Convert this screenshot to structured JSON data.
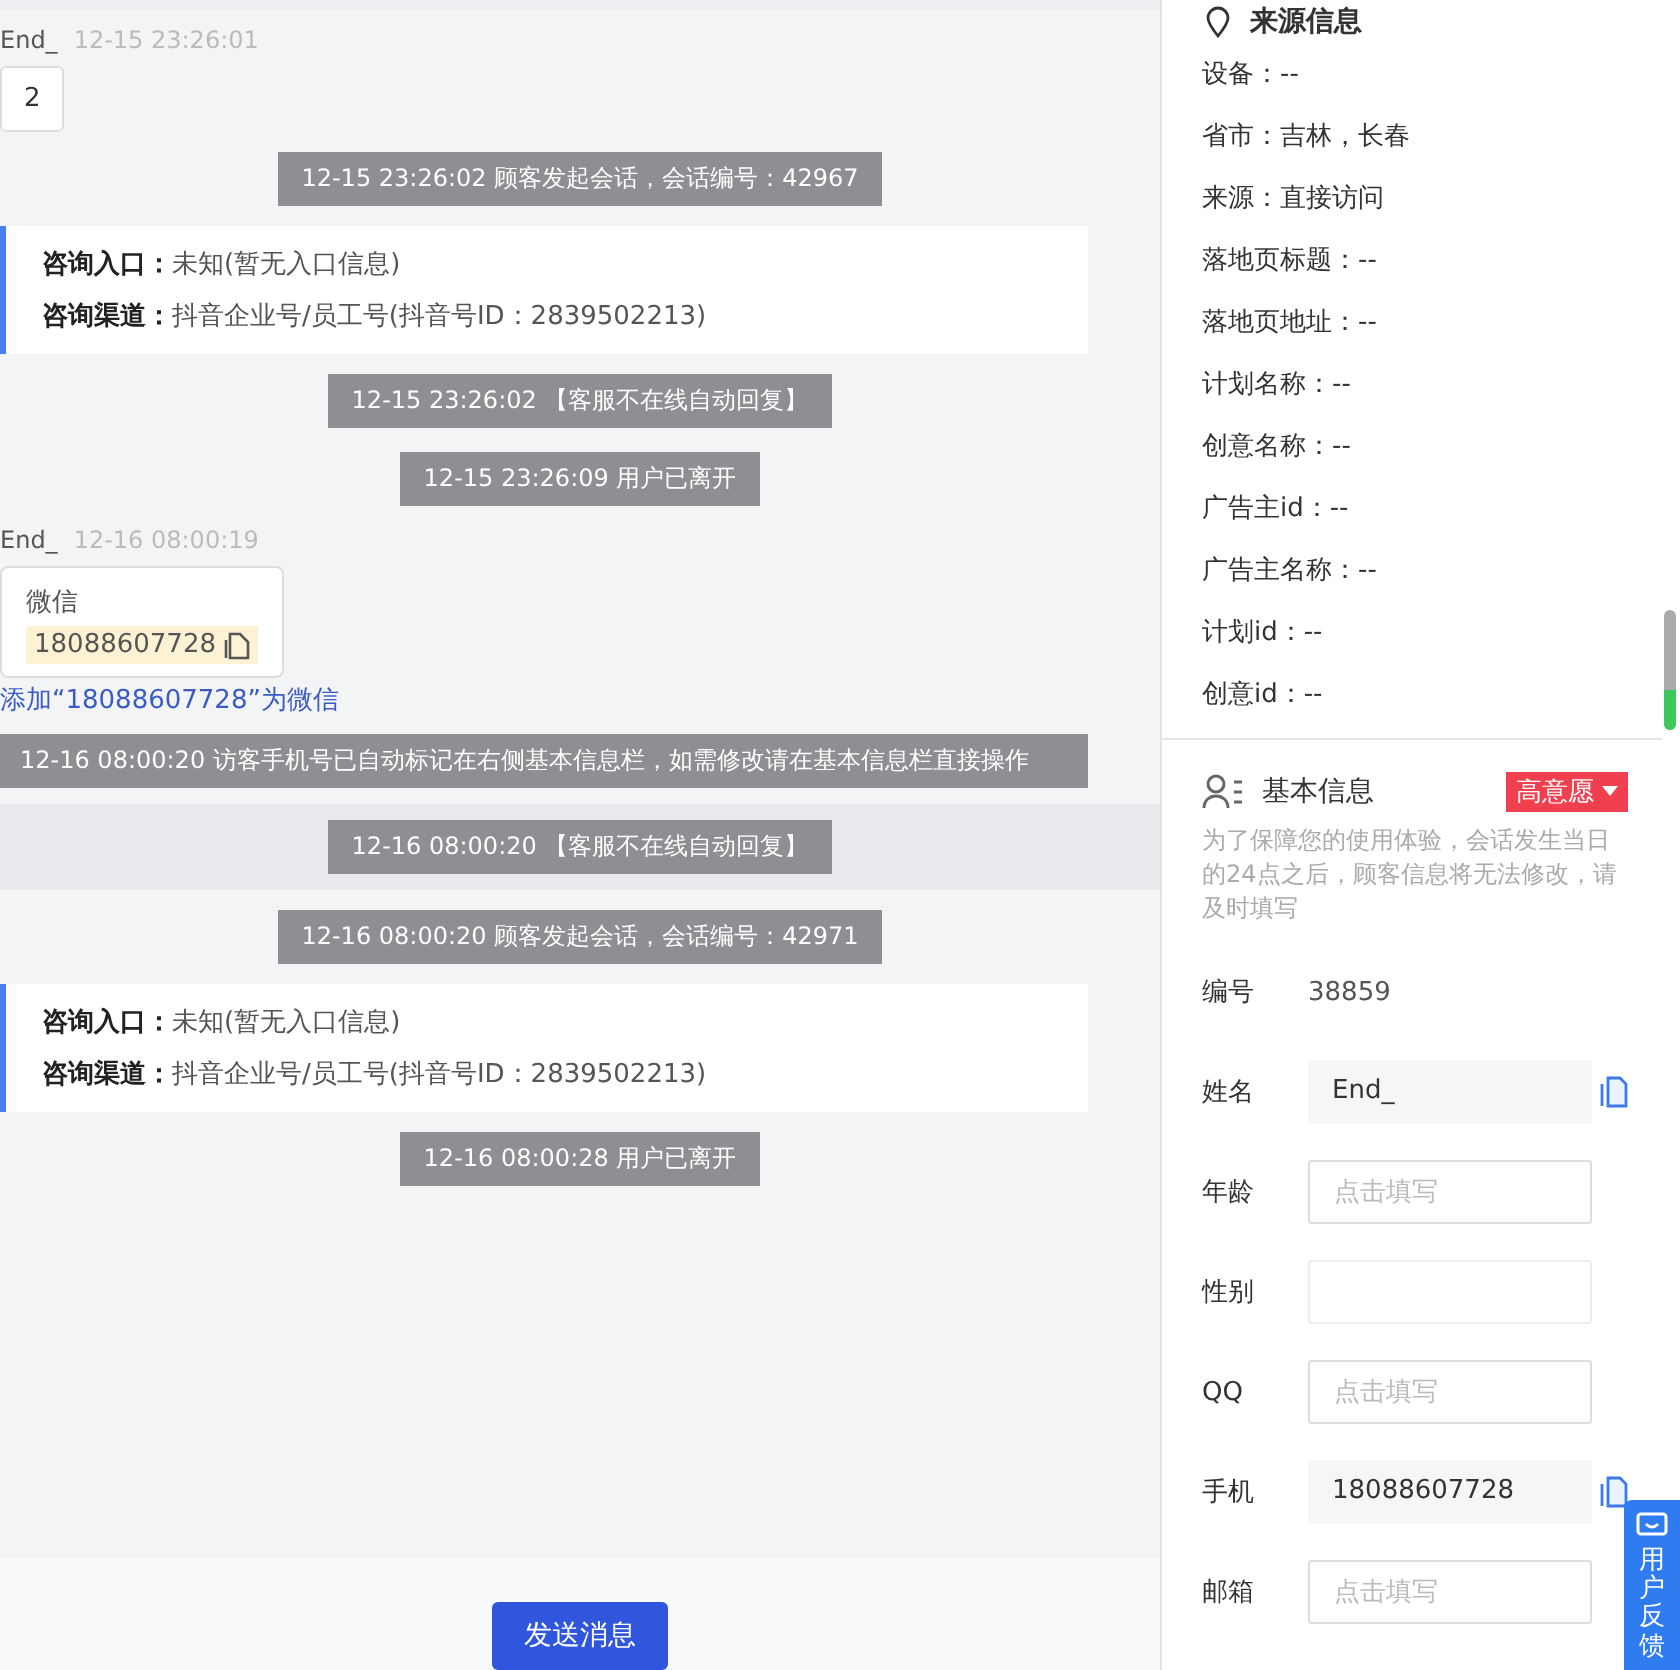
{
  "chat": {
    "messages": [
      {
        "kind": "user",
        "sender": "End_",
        "time": "12-15 23:26:01",
        "text": "2"
      },
      {
        "kind": "system",
        "highlighted": false,
        "text": "12-15 23:26:02 顾客发起会话，会话编号：42967"
      },
      {
        "kind": "consult",
        "rows": [
          {
            "label": "咨询入口：",
            "value": "未知(暂无入口信息)"
          },
          {
            "label": "咨询渠道：",
            "value": "抖音企业号/员工号(抖音号ID：2839502213)"
          }
        ]
      },
      {
        "kind": "system",
        "highlighted": false,
        "text": "12-15 23:26:02 【客服不在线自动回复】"
      },
      {
        "kind": "system",
        "highlighted": false,
        "text": "12-15 23:26:09 用户已离开"
      },
      {
        "kind": "card",
        "sender": "End_",
        "time": "12-16 08:00:19",
        "title": "微信",
        "value": "18088607728",
        "link": "添加“18088607728”为微信"
      },
      {
        "kind": "notice",
        "text": "12-16 08:00:20 访客手机号已自动标记在右侧基本信息栏，如需修改请在基本信息栏直接操作"
      },
      {
        "kind": "system",
        "highlighted": true,
        "text": "12-16 08:00:20 【客服不在线自动回复】"
      },
      {
        "kind": "system",
        "highlighted": false,
        "text": "12-16 08:00:20 顾客发起会话，会话编号：42971"
      },
      {
        "kind": "consult",
        "rows": [
          {
            "label": "咨询入口：",
            "value": "未知(暂无入口信息)"
          },
          {
            "label": "咨询渠道：",
            "value": "抖音企业号/员工号(抖音号ID：2839502213)"
          }
        ]
      },
      {
        "kind": "system",
        "highlighted": false,
        "text": "12-16 08:00:28 用户已离开"
      }
    ]
  },
  "send_button": "发送消息",
  "source_info": {
    "title": "来源信息",
    "items": [
      "设备：--",
      "省市：吉林，长春",
      "来源：直接访问",
      "落地页标题：--",
      "落地页地址：--",
      "计划名称：--",
      "创意名称：--",
      "广告主id：--",
      "广告主名称：--",
      "计划id：--",
      "创意id：--"
    ]
  },
  "basic_info": {
    "title": "基本信息",
    "tag": "高意愿",
    "note": "为了保障您的使用体验，会话发生当日的24点之后，顾客信息将无法修改，请及时填写",
    "fields": [
      {
        "label": "编号",
        "kind": "text",
        "value": "38859"
      },
      {
        "label": "姓名",
        "kind": "readonly",
        "value": "End_"
      },
      {
        "label": "年龄",
        "kind": "input",
        "placeholder": "点击填写"
      },
      {
        "label": "性别",
        "kind": "select"
      },
      {
        "label": "QQ",
        "kind": "input",
        "placeholder": "点击填写"
      },
      {
        "label": "手机",
        "kind": "readonly",
        "value": "18088607728"
      },
      {
        "label": "邮箱",
        "kind": "input",
        "placeholder": "点击填写"
      }
    ]
  },
  "feedback_tab": "用户反馈"
}
